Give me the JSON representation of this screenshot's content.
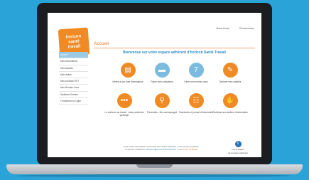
{
  "topnav": {
    "contact": "Nous écrire",
    "logout": "Déconnexion"
  },
  "logo": {
    "line1": "horizon",
    "line2": "santé",
    "line3": "travail"
  },
  "page_title": "Accueil",
  "sidebar": {
    "items": [
      {
        "label": "Accueil"
      },
      {
        "label": "Mes informations"
      },
      {
        "label": "Mes salariés"
      },
      {
        "label": "Mes visites"
      },
      {
        "label": "Mes contacts HST"
      },
      {
        "label": "Mes Rendez-Vous"
      },
      {
        "label": "Synthèse Dossier"
      },
      {
        "label": "Formations en Ligne"
      }
    ]
  },
  "welcome": "Bienvenue sur votre espace adhérent d'horizon Santé Travail",
  "tiles": [
    {
      "label": "Mettre à jour mes informations",
      "icon": "document-icon",
      "color": "#f08a24"
    },
    {
      "label": "Payer mes cotisations",
      "icon": "credit-card-icon",
      "color": "#7cbbe0"
    },
    {
      "label": "Gérer mes rendez-vous",
      "icon": "calendar-icon",
      "color": "#7cbbe0"
    },
    {
      "label": "Déclarer mes salariés",
      "icon": "pencil-icon",
      "color": "#f08a24"
    },
    {
      "label": "Le médecin du travail : votre partenaire privilégié",
      "icon": "chat-icon",
      "color": "#f08a24"
    },
    {
      "label": "Prévention : être accompagné",
      "icon": "magnifier-icon",
      "color": "#f08a24"
    },
    {
      "label": "Fascicules et journal d'information",
      "icon": "newspaper-icon",
      "color": "#f08a24"
    },
    {
      "label": "Participer aux ateliers d'information",
      "icon": "hand-icon",
      "color": "#f08a24"
    }
  ],
  "footer": {
    "line1": "Pour toutes demandes concernant cet espace adhérent, vous pouvez contacter",
    "line2_pre": "le service \"Adhésion\"",
    "email": "adhesion@horizonsantetravail.fr",
    "line2_mid": "ou au",
    "phone": "01 41 37 80 00"
  },
  "info_button": {
    "symbol": "i",
    "line1": "Les 5 étapes",
    "line2": "de l'espace adhérent"
  }
}
